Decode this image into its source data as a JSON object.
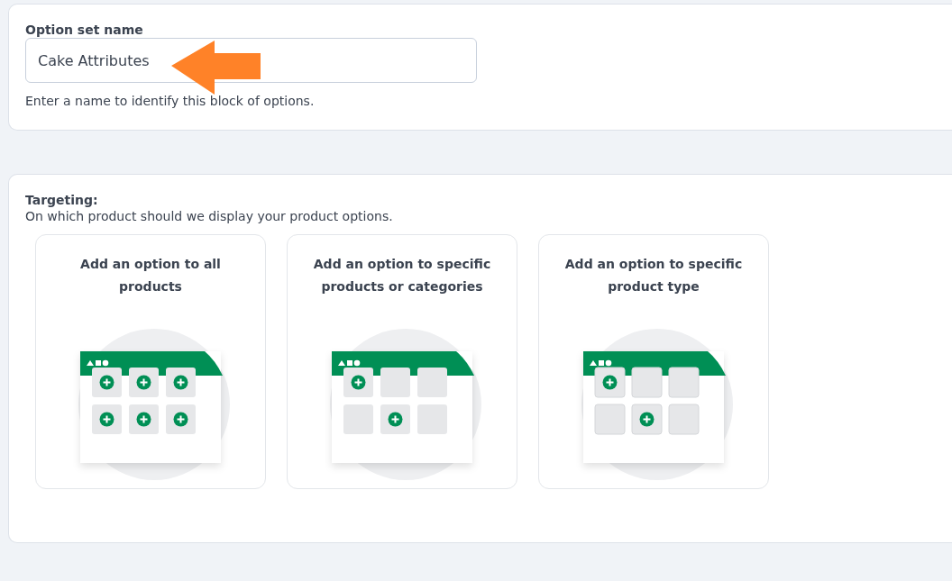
{
  "name_section": {
    "label": "Option set name",
    "value": "Cake Attributes",
    "help": "Enter a name to identify this block of options."
  },
  "targeting": {
    "title": "Targeting:",
    "description": "On which product should we display your product options.",
    "cards": [
      {
        "title": "Add an option to all products",
        "kind": "all"
      },
      {
        "title": "Add an option to specific products or categories",
        "kind": "specific"
      },
      {
        "title": "Add an option to specific product type",
        "kind": "type"
      }
    ]
  }
}
